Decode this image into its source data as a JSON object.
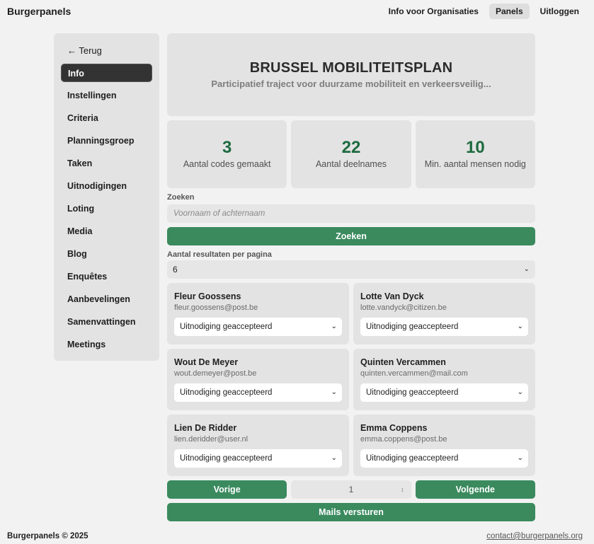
{
  "brand": "Burgerpanels",
  "topnav": [
    {
      "label": "Info voor Organisaties",
      "active": false
    },
    {
      "label": "Panels",
      "active": true
    },
    {
      "label": "Uitloggen",
      "active": false
    }
  ],
  "sidebar": {
    "back_label": "← Terug",
    "items": [
      {
        "label": "Info",
        "active": true
      },
      {
        "label": "Instellingen"
      },
      {
        "label": "Criteria"
      },
      {
        "label": "Planningsgroep"
      },
      {
        "label": "Taken"
      },
      {
        "label": "Uitnodigingen"
      },
      {
        "label": "Loting"
      },
      {
        "label": "Media"
      },
      {
        "label": "Blog"
      },
      {
        "label": "Enquêtes"
      },
      {
        "label": "Aanbevelingen"
      },
      {
        "label": "Samenvattingen"
      },
      {
        "label": "Meetings"
      }
    ]
  },
  "hero": {
    "title": "BRUSSEL MOBILITEITSPLAN",
    "subtitle": "Participatief traject voor duurzame mobiliteit en verkeersveilig..."
  },
  "stats": [
    {
      "value": "3",
      "label": "Aantal codes gemaakt"
    },
    {
      "value": "22",
      "label": "Aantal deelnames"
    },
    {
      "value": "10",
      "label": "Min. aantal mensen nodig"
    }
  ],
  "search": {
    "label": "Zoeken",
    "placeholder": "Voornaam of achternaam",
    "button_label": "Zoeken"
  },
  "per_page": {
    "label": "Aantal resultaten per pagina",
    "value": "6"
  },
  "participants": [
    {
      "name": "Fleur Goossens",
      "email": "fleur.goossens@post.be",
      "status": "Uitnodiging geaccepteerd"
    },
    {
      "name": "Lotte Van Dyck",
      "email": "lotte.vandyck@citizen.be",
      "status": "Uitnodiging geaccepteerd"
    },
    {
      "name": "Wout De Meyer",
      "email": "wout.demeyer@post.be",
      "status": "Uitnodiging geaccepteerd"
    },
    {
      "name": "Quinten Vercammen",
      "email": "quinten.vercammen@mail.com",
      "status": "Uitnodiging geaccepteerd"
    },
    {
      "name": "Lien De Ridder",
      "email": "lien.deridder@user.nl",
      "status": "Uitnodiging geaccepteerd"
    },
    {
      "name": "Emma Coppens",
      "email": "emma.coppens@post.be",
      "status": "Uitnodiging geaccepteerd"
    }
  ],
  "pager": {
    "prev_label": "Vorige",
    "page": "1",
    "next_label": "Volgende"
  },
  "mail_button_label": "Mails versturen",
  "footer": {
    "copyright": "Burgerpanels © 2025",
    "contact": "contact@burgerpanels.org"
  },
  "colors": {
    "accent_green": "#3a8a5e",
    "stat_green": "#1e6b40",
    "active_dark": "#333333"
  }
}
